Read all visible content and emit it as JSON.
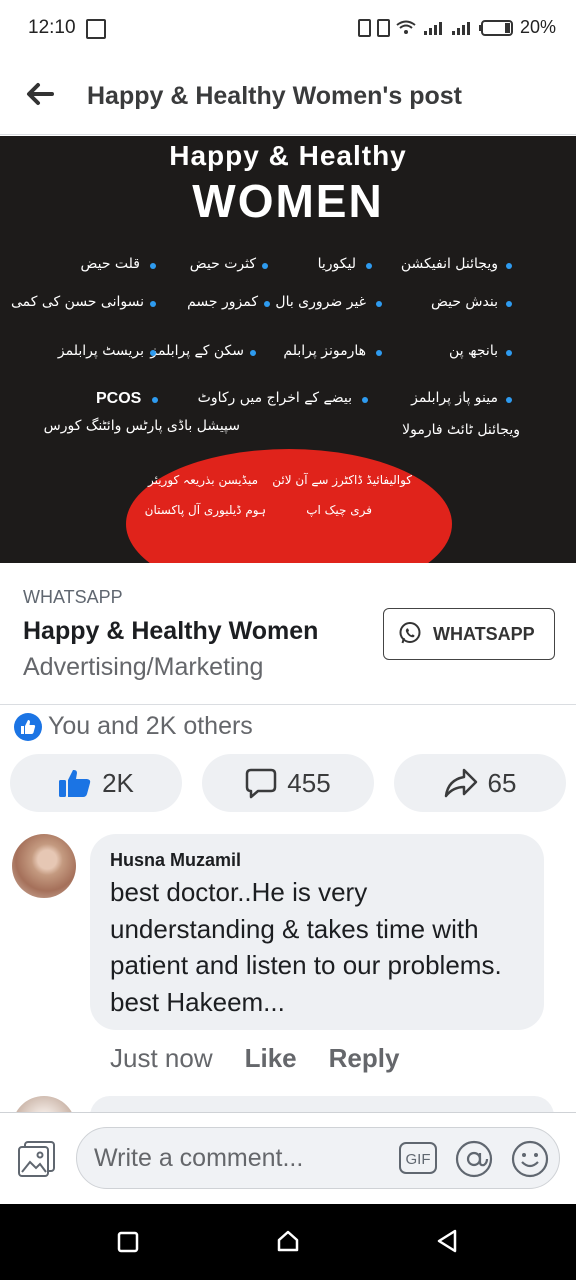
{
  "status_bar": {
    "time": "12:10",
    "battery": "20%"
  },
  "header": {
    "title": "Happy & Healthy Women's post"
  },
  "ad": {
    "title_line1": "Happy & Healthy",
    "title_line2": "WOMEN",
    "items": [
      "ویجائنل انفیکشن",
      "لیکوریا",
      "کثرت حیض",
      "قلت حیض",
      "بندش حیض",
      "غیر ضروری بال",
      "کمزور جسم",
      "نسوانی حسن کی کمی",
      "بانجھ پن",
      "ھارمونز پرابلم",
      "سکن کے پرابلمز",
      "بریسٹ پرابلمز",
      "مینو پاز پرابلمز",
      "بیضے کے اخراج میں رکاوٹ",
      "PCOS",
      "ویجائنل ٹائٹ فارمولا",
      "سپیشل باڈی پارٹس وائٹنگ کورس"
    ],
    "offers": [
      "کوالیفائیڈ ڈاکٹرز سے آن لائن",
      "فری چیک اپ",
      "میڈیسن بذریعہ کوریئر",
      "ہوم ڈیلیوری آل پاکستان"
    ]
  },
  "cta_card": {
    "label": "WHATSAPP",
    "name": "Happy & Healthy Women",
    "category": "Advertising/Marketing",
    "button": "WHATSAPP"
  },
  "reactions": {
    "summary": "You and 2K others",
    "likes": "2K",
    "comments": "455",
    "shares": "65"
  },
  "comment": {
    "author": "Husna Muzamil",
    "text": "best doctor..He is very understanding & takes time with patient and listen to our problems. best Hakeem...",
    "time": "Just now",
    "like": "Like",
    "reply": "Reply"
  },
  "composer": {
    "placeholder": "Write a comment...",
    "gif": "GIF"
  },
  "colors": {
    "accent": "#1b74e4",
    "ad_bg": "#1d1b1a",
    "ad_red": "#e0231b",
    "ad_dot": "#2e9bf0"
  },
  "icons": [
    "back-arrow-icon",
    "whatsapp-icon",
    "like-icon",
    "comment-icon",
    "share-icon",
    "photo-icon",
    "gif-icon",
    "mention-icon",
    "emoji-icon",
    "recent-apps-icon",
    "home-icon",
    "back-nav-icon"
  ]
}
